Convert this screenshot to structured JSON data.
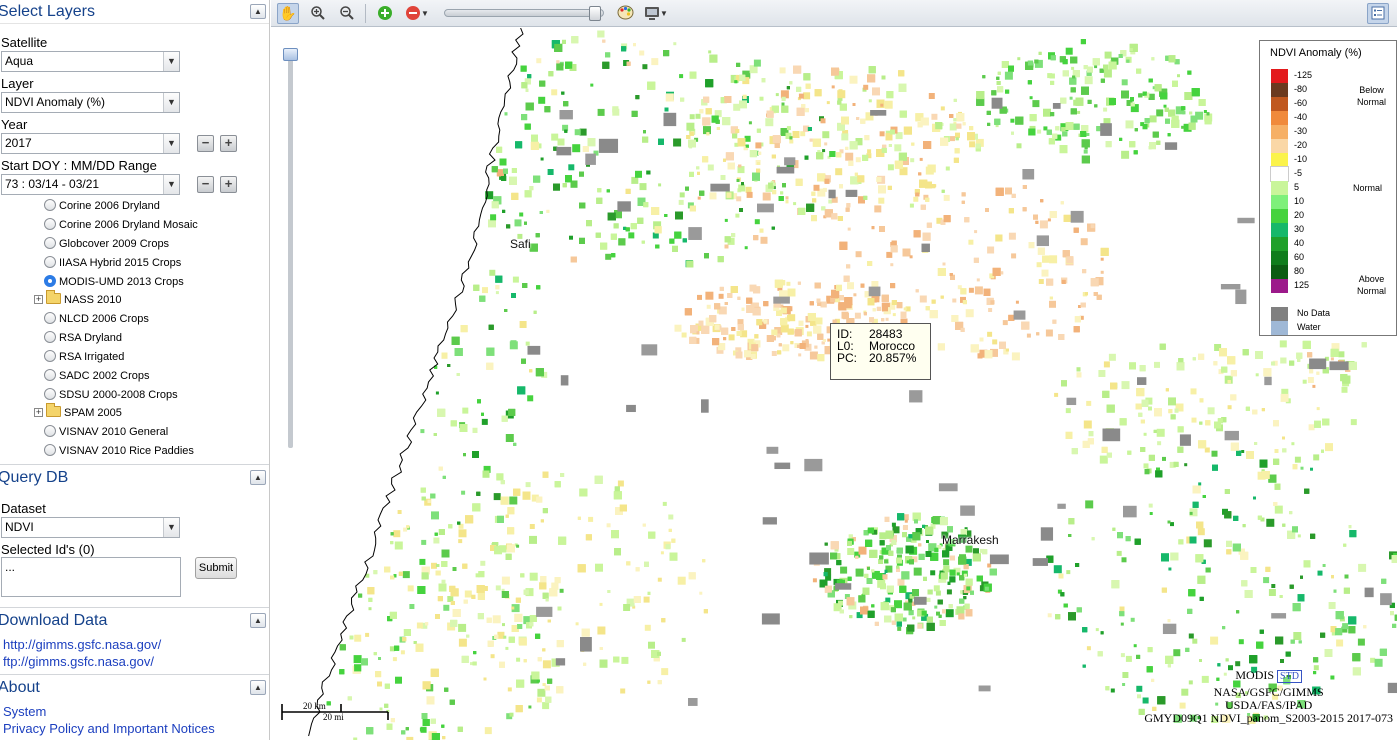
{
  "left_panel": {
    "select_layers": {
      "title": "Select Layers",
      "satellite_label": "Satellite",
      "satellite_value": "Aqua",
      "layer_label": "Layer",
      "layer_value": "NDVI Anomaly (%)",
      "year_label": "Year",
      "year_value": "2017",
      "doy_label": "Start DOY : MM/DD Range",
      "doy_value": "73 : 03/14 - 03/21",
      "tree": [
        {
          "label": "Corine 2006 Dryland",
          "type": "radio",
          "selected": false
        },
        {
          "label": "Corine 2006 Dryland Mosaic",
          "type": "radio",
          "selected": false
        },
        {
          "label": "Globcover 2009 Crops",
          "type": "radio",
          "selected": false
        },
        {
          "label": "IIASA Hybrid 2015 Crops",
          "type": "radio",
          "selected": false
        },
        {
          "label": "MODIS-UMD 2013 Crops",
          "type": "radio",
          "selected": true
        },
        {
          "label": "NASS 2010",
          "type": "folder",
          "selected": false
        },
        {
          "label": "NLCD 2006 Crops",
          "type": "radio",
          "selected": false
        },
        {
          "label": "RSA Dryland",
          "type": "radio",
          "selected": false
        },
        {
          "label": "RSA Irrigated",
          "type": "radio",
          "selected": false
        },
        {
          "label": "SADC 2002 Crops",
          "type": "radio",
          "selected": false
        },
        {
          "label": "SDSU 2000-2008 Crops",
          "type": "radio",
          "selected": false
        },
        {
          "label": "SPAM 2005",
          "type": "folder",
          "selected": false
        },
        {
          "label": "VISNAV 2010 General",
          "type": "radio",
          "selected": false
        },
        {
          "label": "VISNAV 2010 Rice Paddies",
          "type": "radio",
          "selected": false
        }
      ]
    },
    "query_db": {
      "title": "Query DB",
      "dataset_label": "Dataset",
      "dataset_value": "NDVI",
      "selected_ids_label": "Selected Id's (0)",
      "selected_ids_value": "...",
      "submit_label": "Submit"
    },
    "download": {
      "title": "Download Data",
      "links": [
        "http://gimms.gsfc.nasa.gov/",
        "ftp://gimms.gsfc.nasa.gov/"
      ]
    },
    "about": {
      "title": "About",
      "links": [
        "System",
        "Privacy Policy and Important Notices"
      ]
    }
  },
  "toolbar": {
    "icons": [
      "pan-icon",
      "zoom-in-icon",
      "zoom-out-icon",
      "add-layer-icon",
      "remove-layer-icon",
      "palette-icon",
      "screen-icon",
      "legend-toggle-icon"
    ]
  },
  "map": {
    "cities": {
      "safi": "Safi",
      "marrakesh": "Marrakesh"
    },
    "tooltip": {
      "id_key": "ID:",
      "id_value": "28483",
      "l0_key": "L0:",
      "l0_value": "Morocco",
      "pc_key": "PC:",
      "pc_value": "20.857%"
    },
    "scale": {
      "km": "20 km",
      "mi": "20 mi"
    },
    "attribution": {
      "line1": "MODIS",
      "std": "STD",
      "line2": "NASA/GSFC/GIMMS",
      "line3": "USDA/FAS/IPAD",
      "line4": "GMYD09Q1 NDVI_panom_S2003-2015 2017-073"
    }
  },
  "legend": {
    "title": "NDVI Anomaly (%)",
    "items": [
      {
        "value": "-125",
        "color": "#e31a1c"
      },
      {
        "value": "-80",
        "color": "#6b3a1f"
      },
      {
        "value": "-60",
        "color": "#c0581f"
      },
      {
        "value": "-40",
        "color": "#f08a3c"
      },
      {
        "value": "-30",
        "color": "#f6b066"
      },
      {
        "value": "-20",
        "color": "#fad7a6"
      },
      {
        "value": "-10",
        "color": "#fbf34b"
      },
      {
        "value": "-5",
        "color": "#ffffff"
      },
      {
        "value": "5",
        "color": "#c9f59a"
      },
      {
        "value": "10",
        "color": "#7ef07a"
      },
      {
        "value": "20",
        "color": "#45d33e"
      },
      {
        "value": "30",
        "color": "#16b86a"
      },
      {
        "value": "40",
        "color": "#1fa02a"
      },
      {
        "value": "60",
        "color": "#0f7d1c"
      },
      {
        "value": "80",
        "color": "#0b5c12"
      },
      {
        "value": "125",
        "color": "#9c1a8a"
      }
    ],
    "below": "Below\nNormal",
    "normal": "Normal",
    "above": "Above\nNormal",
    "nodata_label": "No Data",
    "nodata_color": "#808080",
    "water_label": "Water",
    "water_color": "#9fb8d6"
  }
}
